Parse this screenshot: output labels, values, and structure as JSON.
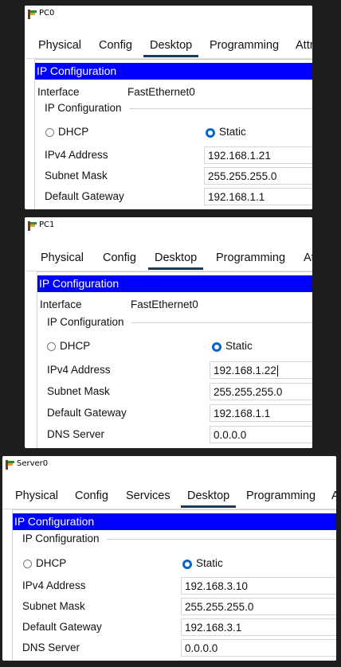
{
  "windows": [
    {
      "title": "PC0",
      "tabs": [
        "Physical",
        "Config",
        "Desktop",
        "Programming",
        "Attr"
      ],
      "active_tab": "Desktop",
      "section_title": "IP Configuration",
      "interface_label": "Interface",
      "interface_value": "FastEthernet0",
      "group_label": "IP Configuration",
      "dhcp_label": "DHCP",
      "static_label": "Static",
      "mode": "Static",
      "rows": [
        {
          "label": "IPv4 Address",
          "value": "192.168.1.21"
        },
        {
          "label": "Subnet Mask",
          "value": "255.255.255.0"
        },
        {
          "label": "Default Gateway",
          "value": "192.168.1.1"
        }
      ]
    },
    {
      "title": "PC1",
      "tabs": [
        "Physical",
        "Config",
        "Desktop",
        "Programming",
        "At"
      ],
      "active_tab": "Desktop",
      "section_title": "IP Configuration",
      "interface_label": "Interface",
      "interface_value": "FastEthernet0",
      "group_label": "IP Configuration",
      "dhcp_label": "DHCP",
      "static_label": "Static",
      "mode": "Static",
      "rows": [
        {
          "label": "IPv4 Address",
          "value": "192.168.1.22"
        },
        {
          "label": "Subnet Mask",
          "value": "255.255.255.0"
        },
        {
          "label": "Default Gateway",
          "value": "192.168.1.1"
        },
        {
          "label": "DNS Server",
          "value": "0.0.0.0"
        }
      ]
    },
    {
      "title": "Server0",
      "tabs": [
        "Physical",
        "Config",
        "Services",
        "Desktop",
        "Programming",
        "A"
      ],
      "active_tab": "Desktop",
      "section_title": "IP Configuration",
      "group_label": "IP Configuration",
      "dhcp_label": "DHCP",
      "static_label": "Static",
      "mode": "Static",
      "rows": [
        {
          "label": "IPv4 Address",
          "value": "192.168.3.10"
        },
        {
          "label": "Subnet Mask",
          "value": "255.255.255.0"
        },
        {
          "label": "Default Gateway",
          "value": "192.168.3.1"
        },
        {
          "label": "DNS Server",
          "value": "0.0.0.0"
        }
      ]
    }
  ]
}
